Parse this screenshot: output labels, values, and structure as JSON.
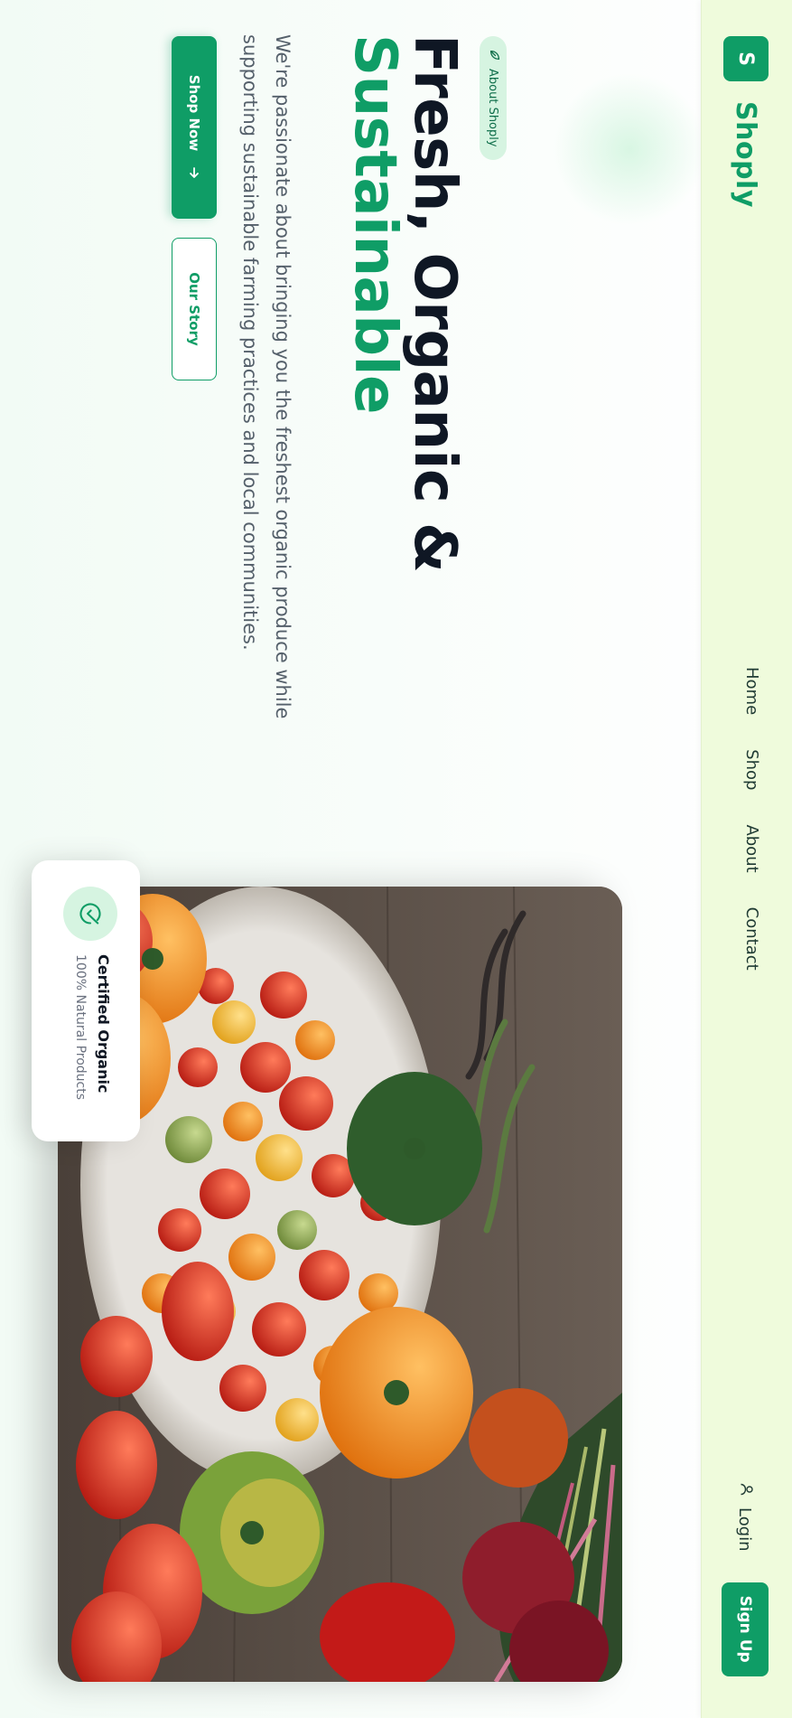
{
  "brand": {
    "logo_letter": "S",
    "name": "Shoply"
  },
  "nav": {
    "links": [
      "Home",
      "Shop",
      "About",
      "Contact"
    ],
    "login": "Login",
    "signup": "Sign Up"
  },
  "hero": {
    "badge": "About Shoply",
    "headline_line1": "Fresh, Organic &",
    "headline_line2": "Sustainable",
    "description": "We're passionate about bringing you the freshest organic produce while supporting sustainable farming practices and local communities.",
    "primary_button": "Shop Now",
    "secondary_button": "Our Story"
  },
  "card": {
    "title": "Certified Organic",
    "subtitle": "100% Natural Products"
  },
  "icons": [
    "leaf-icon",
    "user-icon",
    "arrow-right-icon",
    "check-circle-icon"
  ],
  "colors": {
    "accent": "#0f9d66",
    "nav_bg": "#effbdc",
    "badge_bg": "#d6f4e1",
    "heading": "#0f1724"
  }
}
